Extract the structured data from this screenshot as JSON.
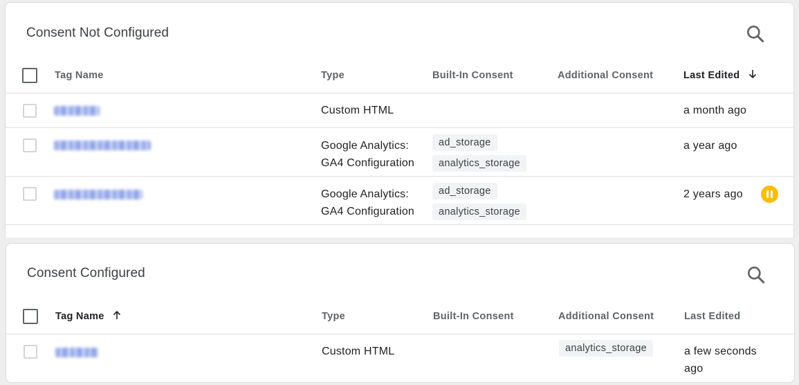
{
  "not_configured": {
    "title": "Consent Not Configured",
    "columns": {
      "tag_name": "Tag Name",
      "type": "Type",
      "built_in": "Built-In Consent",
      "additional": "Additional Consent",
      "last_edited": "Last Edited"
    },
    "sort": {
      "column": "Last Edited",
      "direction": "descending",
      "icon": "arrow-down-icon"
    },
    "rows": [
      {
        "type_line1": "Custom HTML",
        "type_line2": "",
        "built_in": [],
        "additional": [],
        "last_edited": "a month ago",
        "paused": false
      },
      {
        "type_line1": "Google Analytics:",
        "type_line2": "GA4 Configuration",
        "built_in": [
          "ad_storage",
          "analytics_storage"
        ],
        "additional": [],
        "last_edited": "a year ago",
        "paused": false
      },
      {
        "type_line1": "Google Analytics:",
        "type_line2": "GA4 Configuration",
        "built_in": [
          "ad_storage",
          "analytics_storage"
        ],
        "additional": [],
        "last_edited": "2 years ago",
        "paused": true
      }
    ]
  },
  "configured": {
    "title": "Consent Configured",
    "columns": {
      "tag_name": "Tag Name",
      "type": "Type",
      "built_in": "Built-In Consent",
      "additional": "Additional Consent",
      "last_edited": "Last Edited"
    },
    "sort": {
      "column": "Tag Name",
      "direction": "ascending",
      "icon": "arrow-up-icon"
    },
    "rows": [
      {
        "type_line1": "Custom HTML",
        "type_line2": "",
        "built_in": [],
        "additional": [
          "analytics_storage"
        ],
        "last_edited_line1": "a few seconds",
        "last_edited_line2": "ago",
        "paused": false
      }
    ]
  },
  "colors": {
    "paused": "#fbbc04",
    "chip_bg": "#f1f3f4",
    "header_text": "#5f6368",
    "blurred_link": "#8aa0e8"
  }
}
